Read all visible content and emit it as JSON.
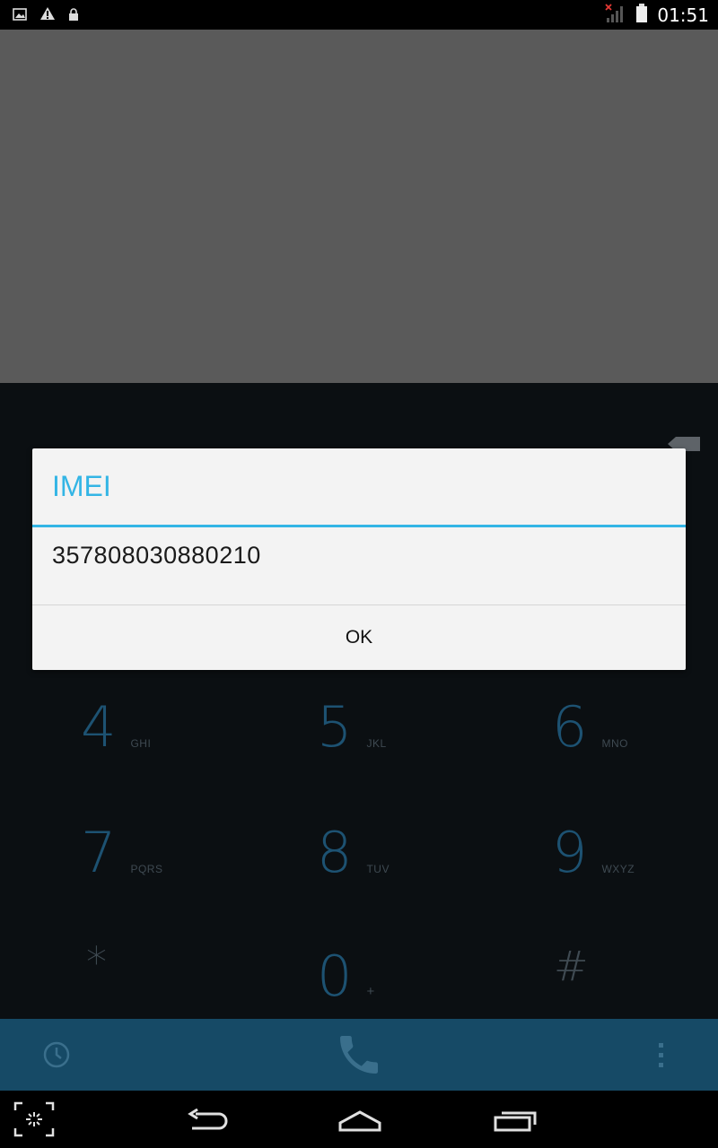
{
  "status_bar": {
    "time": "01:51",
    "icons": [
      "image-notification-icon",
      "warning-icon",
      "lock-icon",
      "no-signal-icon",
      "battery-icon"
    ]
  },
  "dialer": {
    "keys": [
      {
        "num": "4",
        "letters": "GHI"
      },
      {
        "num": "5",
        "letters": "JKL"
      },
      {
        "num": "6",
        "letters": "MNO"
      },
      {
        "num": "7",
        "letters": "PQRS"
      },
      {
        "num": "8",
        "letters": "TUV"
      },
      {
        "num": "9",
        "letters": "WXYZ"
      },
      {
        "num": "*",
        "letters": ""
      },
      {
        "num": "0",
        "letters": "+"
      },
      {
        "num": "#",
        "letters": ""
      }
    ]
  },
  "dialog": {
    "title": "IMEI",
    "message": "357808030880210",
    "ok_label": "OK"
  },
  "action_bar": {
    "icons": [
      "call-history-icon",
      "phone-icon",
      "overflow-menu-icon"
    ]
  },
  "nav_bar": {
    "icons": [
      "screenshot-icon",
      "back-icon",
      "home-icon",
      "recents-icon"
    ]
  },
  "colors": {
    "accent": "#33b5e5",
    "action_bar": "#164a66",
    "dialer_bg": "#0b0f12",
    "dim_top": "#5a5a5a"
  }
}
